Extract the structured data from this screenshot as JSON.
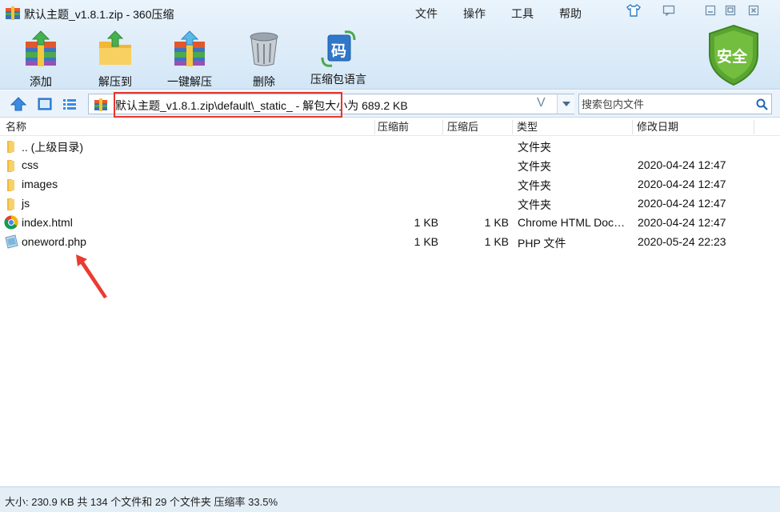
{
  "window": {
    "title": "默认主题_v1.8.1.zip - 360压缩",
    "menu": [
      "文件",
      "操作",
      "工具",
      "帮助"
    ],
    "controls": [
      "shirt-icon",
      "chat-icon",
      "minimize-icon",
      "maximize-icon",
      "close-icon"
    ]
  },
  "toolbar": {
    "add_label": "添加",
    "extract_to_label": "解压到",
    "one_click_label": "一键解压",
    "delete_label": "删除",
    "encoding_label": "压缩包语言",
    "encoding_glyph": "码",
    "security_badge": "安全"
  },
  "address": {
    "path": "默认主题_v1.8.1.zip\\default\\_static_ - 解包大小为 689.2 KB",
    "v_glyph": "V"
  },
  "search": {
    "placeholder": "搜索包内文件"
  },
  "columns": {
    "name": "名称",
    "compressed_before": "压缩前",
    "compressed_after": "压缩后",
    "type": "类型",
    "modified": "修改日期"
  },
  "files": [
    {
      "name": ".. (上级目录)",
      "before": "",
      "after": "",
      "type": "文件夹",
      "modified": "",
      "icon": "folder-icon"
    },
    {
      "name": "css",
      "before": "",
      "after": "",
      "type": "文件夹",
      "modified": "2020-04-24 12:47",
      "icon": "folder-icon"
    },
    {
      "name": "images",
      "before": "",
      "after": "",
      "type": "文件夹",
      "modified": "2020-04-24 12:47",
      "icon": "folder-icon"
    },
    {
      "name": "js",
      "before": "",
      "after": "",
      "type": "文件夹",
      "modified": "2020-04-24 12:47",
      "icon": "folder-icon"
    },
    {
      "name": "index.html",
      "before": "1 KB",
      "after": "1 KB",
      "type": "Chrome HTML Document",
      "modified": "2020-04-24 12:47",
      "icon": "chrome-icon"
    },
    {
      "name": "oneword.php",
      "before": "1 KB",
      "after": "1 KB",
      "type": "PHP 文件",
      "modified": "2020-05-24 22:23",
      "icon": "php-file-icon"
    }
  ],
  "status": {
    "text": "大小: 230.9 KB 共 134 个文件和 29 个文件夹 压缩率 33.5%"
  },
  "colors": {
    "highlight_box": "#e8352c",
    "annotation_arrow": "#ea3b30",
    "shield_green": "#5aa531"
  }
}
